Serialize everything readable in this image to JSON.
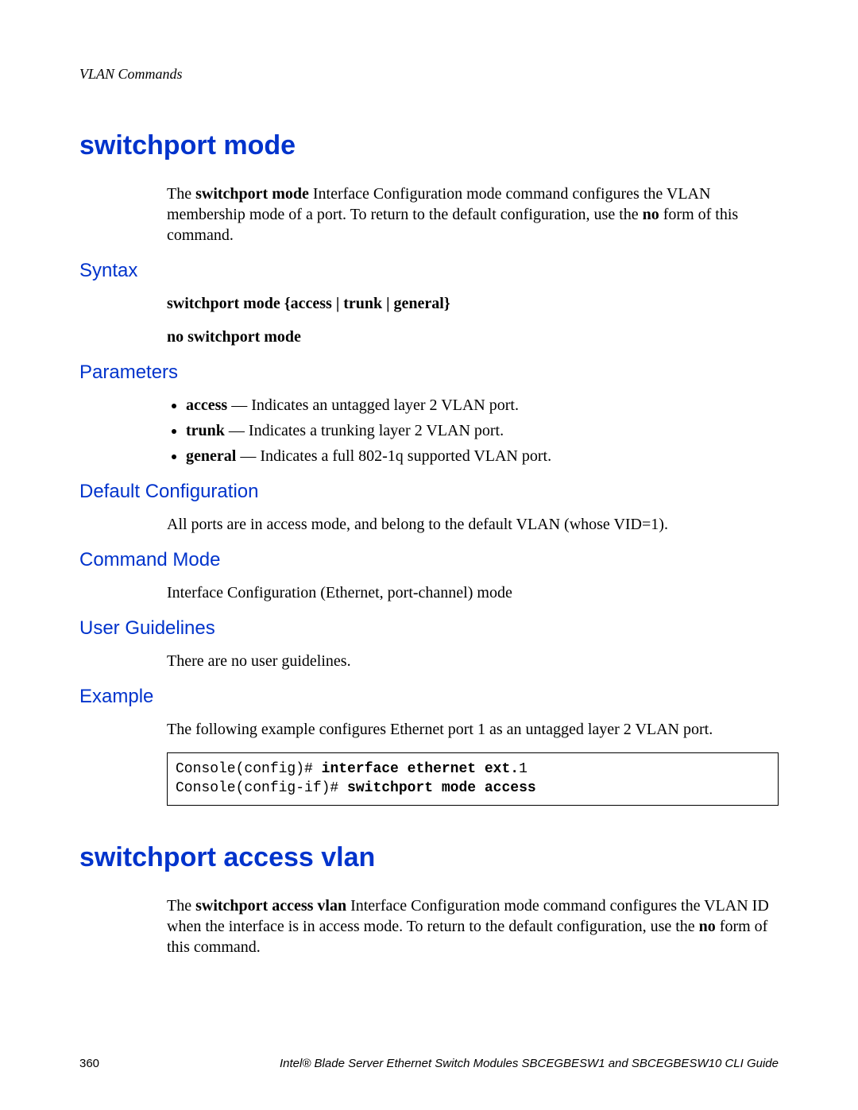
{
  "header": {
    "running_head": "VLAN Commands"
  },
  "sections": [
    {
      "title": "switchport mode",
      "intro": {
        "pre1": "The ",
        "cmd1": "switchport mode",
        "mid1": " Interface Configuration mode command configures the VLAN membership mode of a port. To return to the default configuration, use the ",
        "cmd2": "no",
        "post1": " form of this command."
      },
      "syntax_heading": "Syntax",
      "syntax_lines": [
        "switchport mode {access | trunk | general}",
        "no switchport mode"
      ],
      "parameters_heading": "Parameters",
      "parameters": [
        {
          "name": "access",
          "desc": " — Indicates an untagged layer 2 VLAN port."
        },
        {
          "name": "trunk",
          "desc": " — Indicates a trunking layer 2 VLAN port."
        },
        {
          "name": "general",
          "desc": " — Indicates a full 802-1q supported VLAN port."
        }
      ],
      "default_heading": "Default Configuration",
      "default_text": "All ports are in access mode, and belong to the default VLAN (whose VID=1).",
      "mode_heading": "Command Mode",
      "mode_text": "Interface Configuration (Ethernet, port-channel) mode",
      "guidelines_heading": "User Guidelines",
      "guidelines_text": "There are no user guidelines.",
      "example_heading": "Example",
      "example_text": "The following example configures Ethernet port 1 as an untagged layer 2 VLAN port.",
      "example_code": {
        "l1a": "Console(config)# ",
        "l1b": "interface ethernet ext.",
        "l1c": "1",
        "l2a": "Console(config-if)# ",
        "l2b": "switchport mode access"
      }
    },
    {
      "title": "switchport access vlan",
      "intro": {
        "pre1": "The ",
        "cmd1": "switchport access vlan",
        "mid1": " Interface Configuration mode command configures the VLAN ID when the interface is in access mode. To return to the default configuration, use the ",
        "cmd2": "no",
        "post1": " form of this command."
      }
    }
  ],
  "footer": {
    "page_number": "360",
    "guide_title": "Intel® Blade Server Ethernet Switch Modules SBCEGBESW1 and SBCEGBESW10 CLI Guide"
  }
}
